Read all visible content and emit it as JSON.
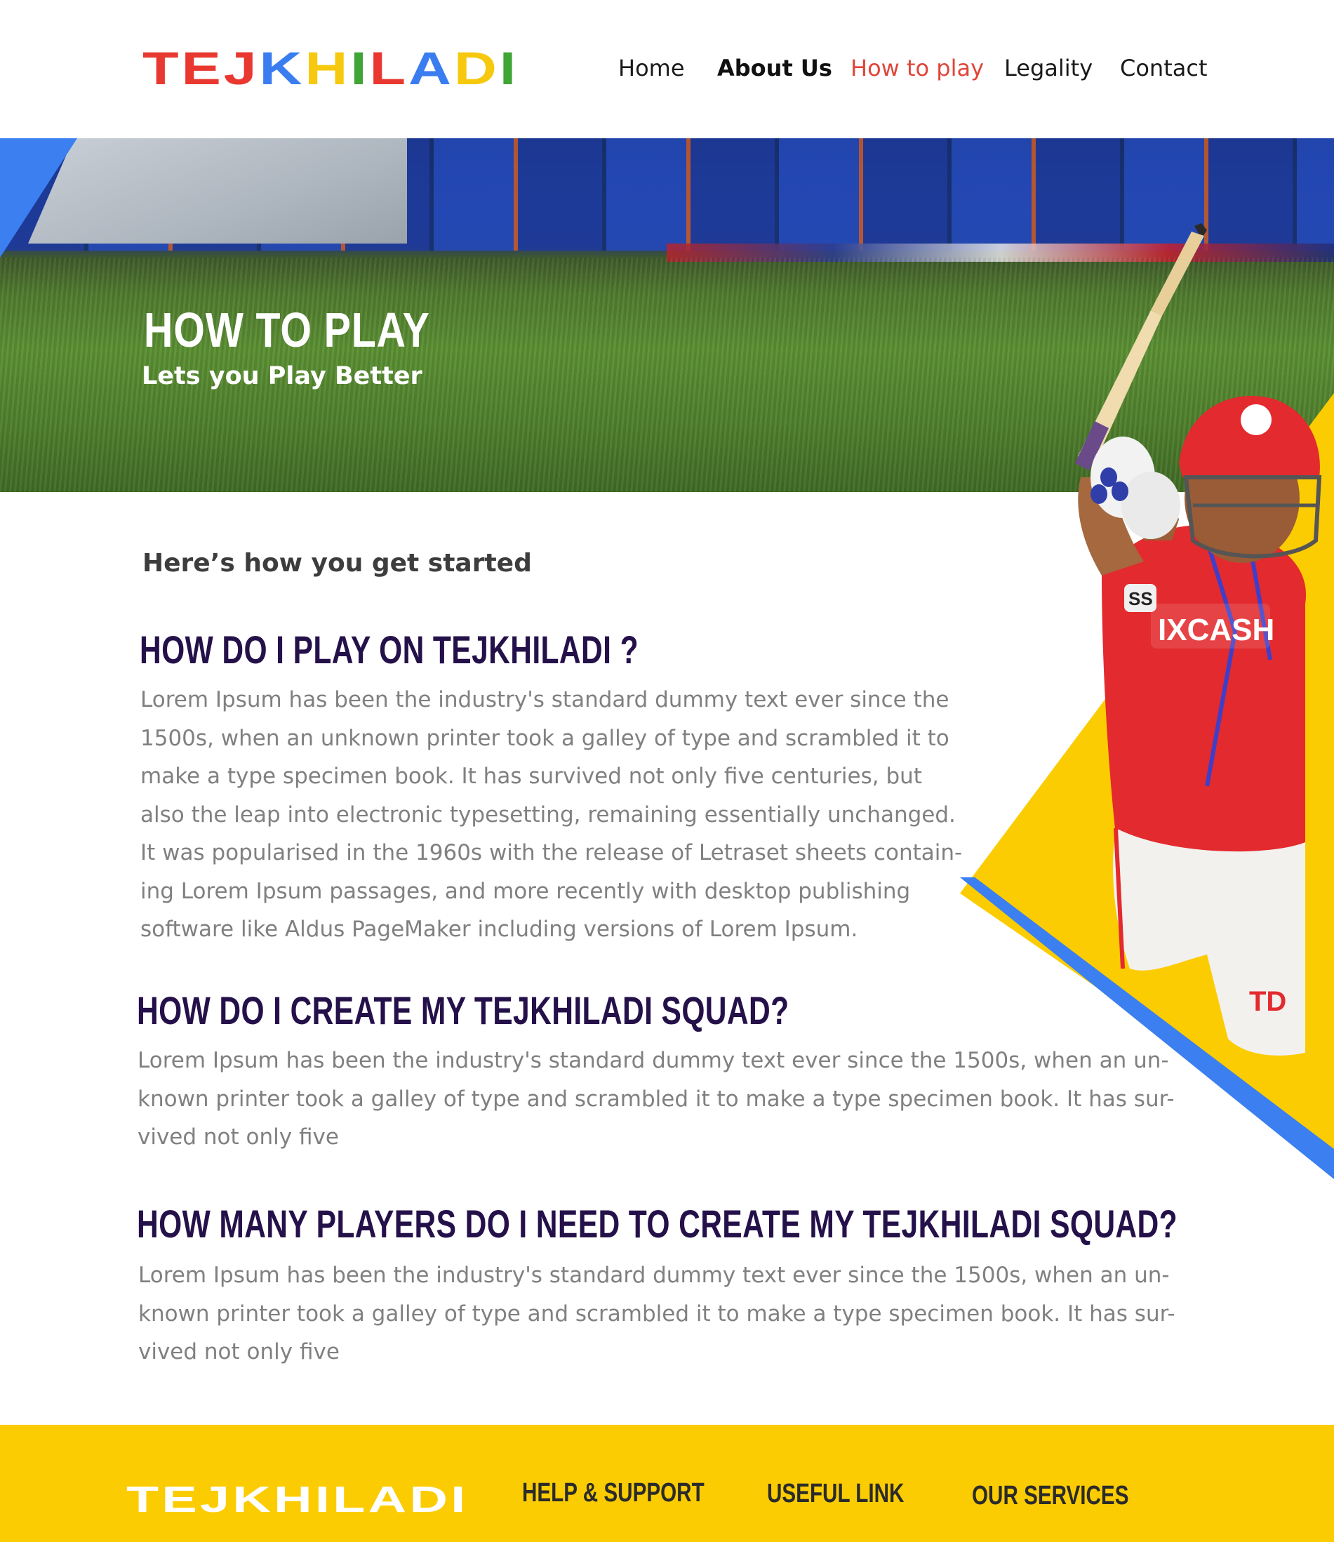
{
  "brand": {
    "logo_letters": [
      {
        "char": "T",
        "color": "#e8382f"
      },
      {
        "char": "E",
        "color": "#e8382f"
      },
      {
        "char": "J",
        "color": "#e8382f"
      },
      {
        "char": "K",
        "color": "#3a7df0"
      },
      {
        "char": "H",
        "color": "#f6c90e"
      },
      {
        "char": "I",
        "color": "#3fa535"
      },
      {
        "char": "L",
        "color": "#e8382f"
      },
      {
        "char": "A",
        "color": "#3a7df0"
      },
      {
        "char": "D",
        "color": "#f6c90e"
      },
      {
        "char": "I",
        "color": "#3fa535"
      }
    ]
  },
  "nav": {
    "items": [
      {
        "label": "Home",
        "color": "#1a1a1a",
        "bold": false
      },
      {
        "label": "About Us",
        "color": "#111111",
        "bold": true
      },
      {
        "label": "How to play",
        "color": "#e0453a",
        "bold": false,
        "active": true
      },
      {
        "label": "Legality",
        "color": "#1a1a1a",
        "bold": false
      },
      {
        "label": "Contact",
        "color": "#1a1a1a",
        "bold": false
      }
    ]
  },
  "hero": {
    "title": "HOW TO PLAY",
    "subtitle": "Lets you Play Better"
  },
  "content": {
    "intro": "Here’s how you get started",
    "sections": [
      {
        "title": "HOW DO I PLAY ON TEJKHILADI ?",
        "lines": [
          "Lorem Ipsum has been the industry's standard dummy text ever since the",
          "1500s, when an unknown printer took a galley of type and scrambled it to",
          "make a type specimen book. It has survived not only five centuries, but",
          "also the leap into electronic typesetting, remaining essentially unchanged.",
          "It was popularised in the 1960s with the release of Letraset sheets contain-",
          "ing Lorem Ipsum passages, and more recently with desktop publishing",
          "software like Aldus PageMaker including versions of Lorem Ipsum."
        ]
      },
      {
        "title": "HOW DO I CREATE MY TEJKHILADI SQUAD?",
        "lines": [
          "Lorem Ipsum has been the industry's standard dummy text ever since the 1500s, when an un-",
          "known printer took a galley of type and scrambled it to make a type specimen book. It has sur-",
          "vived not only five"
        ]
      },
      {
        "title": "HOW MANY PLAYERS DO I NEED TO CREATE MY TEJKHILADI SQUAD?",
        "lines": [
          "Lorem Ipsum has been the industry's standard dummy text ever since the 1500s, when an un-",
          "known printer took a galley of type and scrambled it to make a type specimen book. It has sur-",
          "vived not only five"
        ]
      }
    ]
  },
  "player": {
    "jersey_sponsor": "IXCASH",
    "shorts_logo": "TD",
    "glove_brand": "SS"
  },
  "footer": {
    "logo": "TEJKHILADI",
    "headings": [
      "HELP & SUPPORT",
      "USEFUL LINK",
      "OUR SERVICES"
    ]
  },
  "colors": {
    "accent_yellow": "#fccc02",
    "accent_blue": "#3b7ff0",
    "heading_purple": "#25114a",
    "body_grey": "#808080",
    "nav_active": "#e0453a"
  }
}
